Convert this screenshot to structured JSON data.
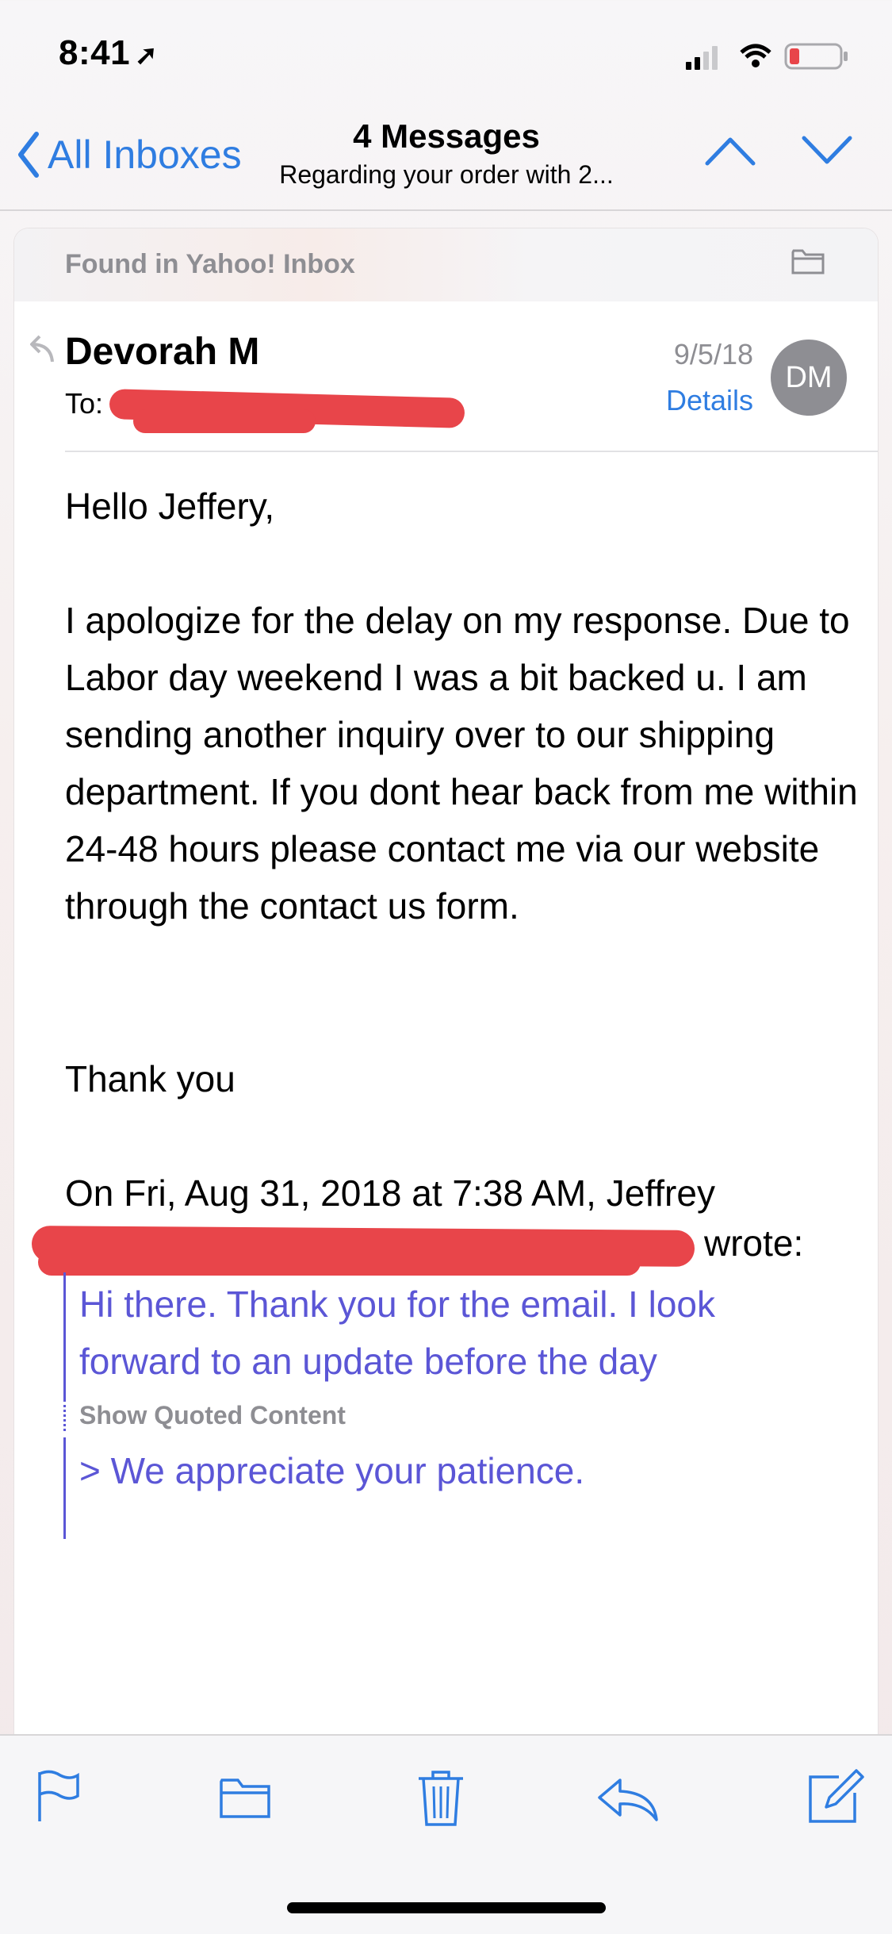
{
  "status": {
    "time": "8:41",
    "location_icon": "location-arrow-icon",
    "battery_color": "#e8454a"
  },
  "nav": {
    "back_label": "All Inboxes",
    "title": "4 Messages",
    "subtitle": "Regarding your order with 2..."
  },
  "message": {
    "found_in": "Found in Yahoo! Inbox",
    "sender": "Devorah M",
    "to_label": "To:",
    "date": "9/5/18",
    "details": "Details",
    "avatar_initials": "DM",
    "greeting": "Hello Jeffery,",
    "body": "I apologize for the delay on my response. Due to Labor day weekend I was a bit backed u. I am sending another inquiry over to our shipping department. If you dont hear back from me within 24-48 hours please contact me via our website through the contact us form.",
    "thanks": "Thank you",
    "quote_header": "On Fri, Aug 31, 2018 at 7:38 AM, Jeffrey",
    "wrote": "wrote:",
    "quote_line1": "Hi there. Thank you for the email. I look",
    "quote_line2": "forward to an update before the day",
    "show_quoted": "Show Quoted Content",
    "quote_line3": "> We appreciate your patience."
  },
  "colors": {
    "accent": "#2f7de1",
    "quote": "#5b56d6",
    "redaction": "#e8454a"
  },
  "toolbar": {
    "icons": [
      "flag-icon",
      "folder-icon",
      "trash-icon",
      "reply-icon",
      "compose-icon"
    ]
  }
}
